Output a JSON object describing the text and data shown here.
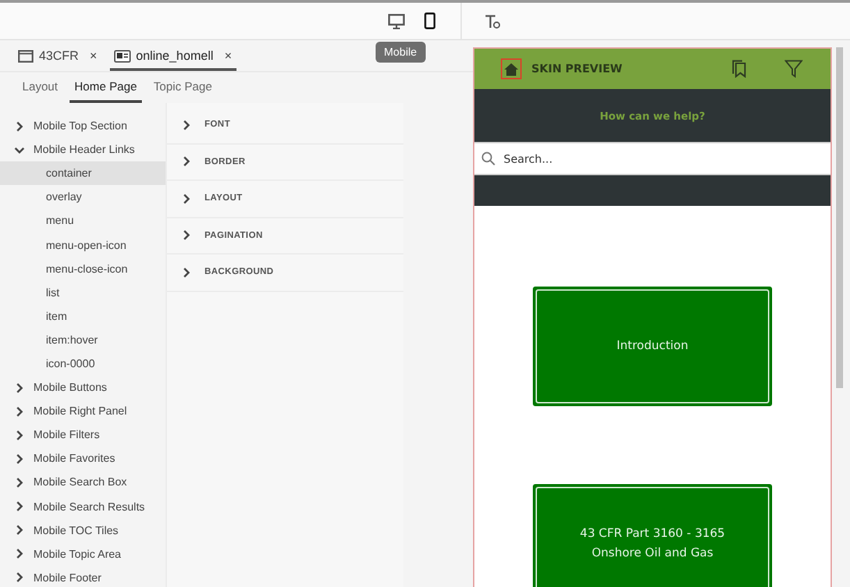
{
  "toolbar": {
    "devices": [
      {
        "kind": "desktop",
        "selected": false
      },
      {
        "kind": "mobile",
        "selected": true
      }
    ],
    "tooltip": "Mobile"
  },
  "document_tabs": [
    {
      "label": "43CFR",
      "close": "×",
      "selected": false
    },
    {
      "label": "online_homell",
      "close": "×",
      "selected": true
    }
  ],
  "view_tabs": [
    {
      "label": "Layout",
      "selected": false
    },
    {
      "label": "Home Page",
      "selected": true
    },
    {
      "label": "Topic Page",
      "selected": false
    }
  ],
  "tree": [
    {
      "label": "Mobile Top Section",
      "expanded": false,
      "selected": false
    },
    {
      "label": "Mobile Header Links",
      "expanded": true,
      "selected": false,
      "children": [
        {
          "label": "container",
          "selected": true
        },
        {
          "label": "overlay",
          "selected": false
        },
        {
          "label": "menu",
          "selected": false
        },
        {
          "label": "menu-open-icon",
          "selected": false
        },
        {
          "label": "menu-close-icon",
          "selected": false
        },
        {
          "label": "list",
          "selected": false
        },
        {
          "label": "item",
          "selected": false
        },
        {
          "label": "item:hover",
          "selected": false
        },
        {
          "label": "icon-0000",
          "selected": false
        }
      ]
    },
    {
      "label": "Mobile Buttons",
      "expanded": false,
      "selected": false
    },
    {
      "label": "Mobile Right Panel",
      "expanded": false,
      "selected": false
    },
    {
      "label": "Mobile Filters",
      "expanded": false,
      "selected": false
    },
    {
      "label": "Mobile Favorites",
      "expanded": false,
      "selected": false
    },
    {
      "label": "Mobile Search Box",
      "expanded": false,
      "selected": false
    },
    {
      "label": "Mobile Search Results",
      "expanded": false,
      "selected": false
    },
    {
      "label": "Mobile TOC Tiles",
      "expanded": false,
      "selected": false
    },
    {
      "label": "Mobile Topic Area",
      "expanded": false,
      "selected": false
    },
    {
      "label": "Mobile Footer",
      "expanded": false,
      "selected": false
    }
  ],
  "property_sections": [
    {
      "label": "FONT",
      "expanded": false
    },
    {
      "label": "BORDER",
      "expanded": false
    },
    {
      "label": "LAYOUT",
      "expanded": false
    },
    {
      "label": "PAGINATION",
      "expanded": false
    },
    {
      "label": "BACKGROUND",
      "expanded": false
    }
  ],
  "preview": {
    "title": "SKIN PREVIEW",
    "heading": "How can we help?",
    "search": {
      "placeholder": "Search..."
    },
    "tiles": [
      {
        "lines": [
          "Introduction"
        ]
      },
      {
        "lines": [
          "43 CFR Part 3160 - 3165",
          "Onshore Oil and Gas"
        ]
      }
    ]
  }
}
